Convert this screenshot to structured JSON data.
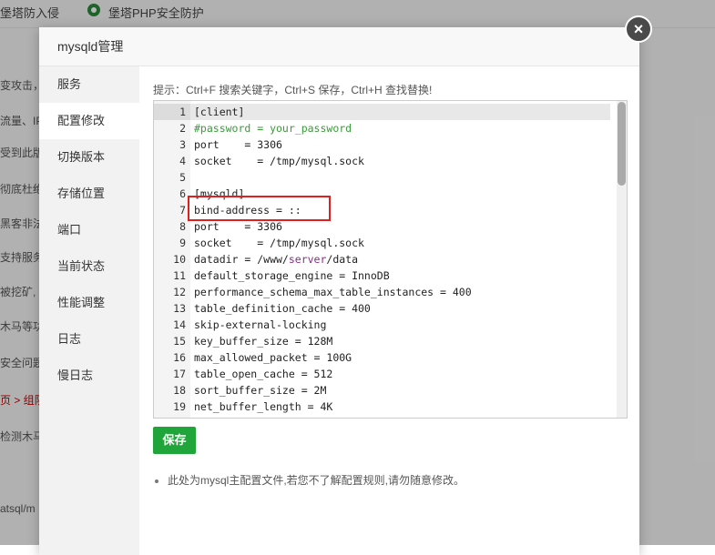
{
  "background": {
    "tabs": [
      {
        "label": "堡塔防入侵"
      },
      {
        "label": "堡塔PHP安全防护"
      }
    ],
    "lines": [
      {
        "text": "变攻击，"
      },
      {
        "text": "流量、IP"
      },
      {
        "text": "受到此版"
      },
      {
        "text": "彻底杜绝"
      },
      {
        "text": "黑客非法"
      },
      {
        "text": "支持服务"
      },
      {
        "text": "被挖矿,"
      },
      {
        "text": "木马等功"
      },
      {
        "text": "安全问题"
      },
      {
        "text": "页 > 组队"
      },
      {
        "text": "检测木马"
      },
      {
        "text": "atsql/m"
      }
    ]
  },
  "modal": {
    "title": "mysqld管理",
    "close_label": "×",
    "sidebar": [
      {
        "label": "服务"
      },
      {
        "label": "配置修改"
      },
      {
        "label": "切换版本"
      },
      {
        "label": "存储位置"
      },
      {
        "label": "端口"
      },
      {
        "label": "当前状态"
      },
      {
        "label": "性能调整"
      },
      {
        "label": "日志"
      },
      {
        "label": "慢日志"
      }
    ],
    "active_sidebar": "配置修改",
    "hint": "提示：Ctrl+F 搜索关键字，Ctrl+S 保存，Ctrl+H 查找替换!",
    "editor": {
      "lines": [
        {
          "n": "1",
          "text": "[client]"
        },
        {
          "n": "2",
          "text": "#password = your_password"
        },
        {
          "n": "3",
          "text": "port    = 3306"
        },
        {
          "n": "4",
          "text": "socket    = /tmp/mysql.sock"
        },
        {
          "n": "5",
          "text": ""
        },
        {
          "n": "6",
          "text": "[mysqld]"
        },
        {
          "n": "7",
          "text": "bind-address = ::"
        },
        {
          "n": "8",
          "text": "port    = 3306"
        },
        {
          "n": "9",
          "text": "socket    = /tmp/mysql.sock"
        },
        {
          "n": "10",
          "text": "datadir = /www/server/data"
        },
        {
          "n": "11",
          "text": "default_storage_engine = InnoDB"
        },
        {
          "n": "12",
          "text": "performance_schema_max_table_instances = 400"
        },
        {
          "n": "13",
          "text": "table_definition_cache = 400"
        },
        {
          "n": "14",
          "text": "skip-external-locking"
        },
        {
          "n": "15",
          "text": "key_buffer_size = 128M"
        },
        {
          "n": "16",
          "text": "max_allowed_packet = 100G"
        },
        {
          "n": "17",
          "text": "table_open_cache = 512"
        },
        {
          "n": "18",
          "text": "sort_buffer_size = 2M"
        },
        {
          "n": "19",
          "text": "net_buffer_length = 4K"
        }
      ]
    },
    "save_label": "保存",
    "note": "此处为mysql主配置文件,若您不了解配置规则,请勿随意修改。"
  },
  "colors": {
    "accent_green": "#20a53a",
    "comment_green": "#3a9a3a",
    "highlight_red": "#e02020"
  }
}
